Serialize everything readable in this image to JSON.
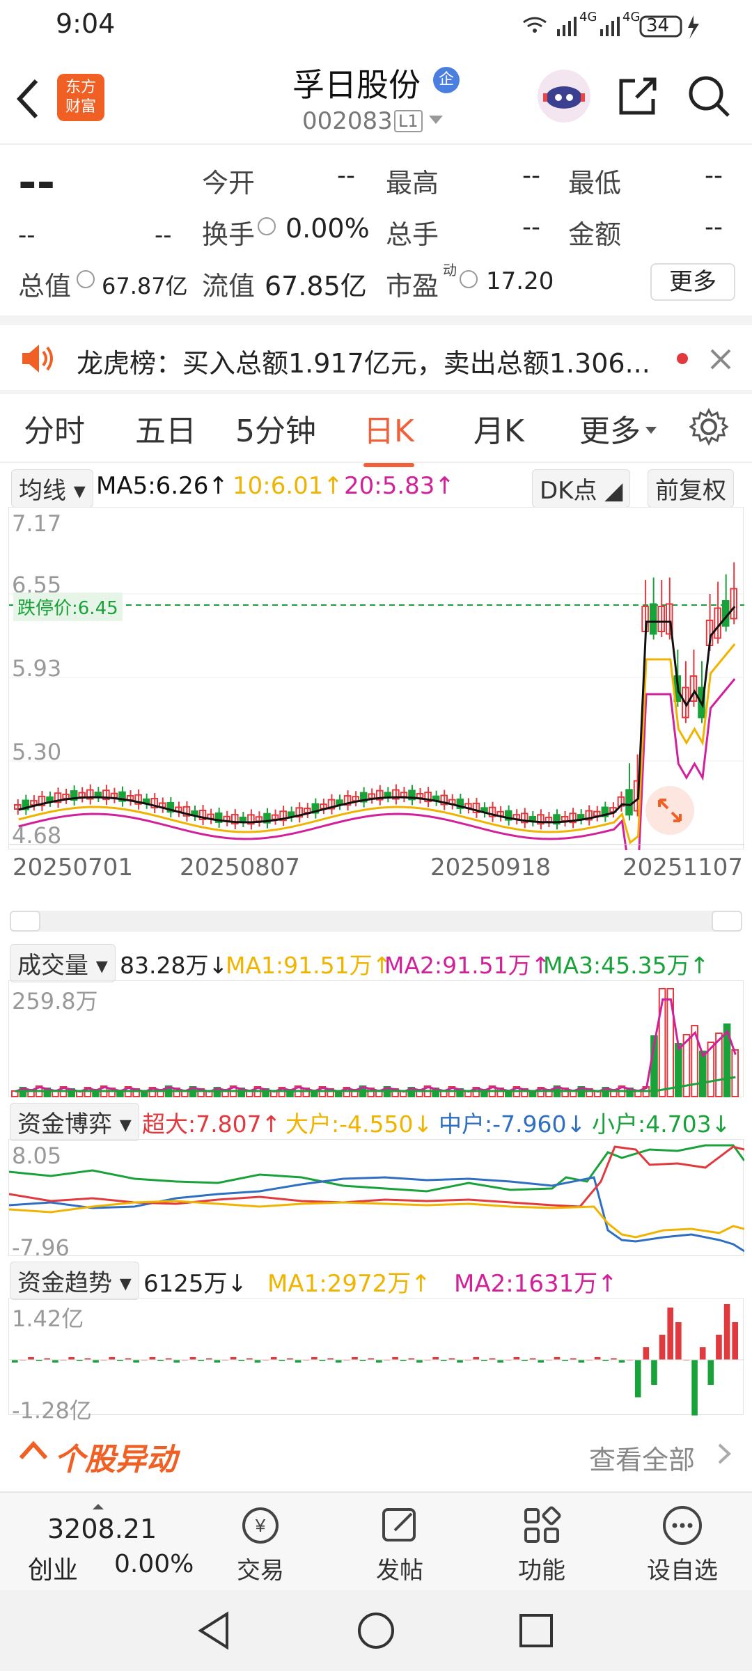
{
  "status": {
    "time": "9:04",
    "net1": "4G",
    "net2": "4G",
    "battery": "34"
  },
  "header": {
    "logo_text": "东方\n财富",
    "logo_line1": "东方",
    "logo_line2": "财富",
    "stock_name": "孚日股份",
    "stock_badge": "企",
    "stock_code": "002083",
    "level": "L1"
  },
  "quote": {
    "price": "--",
    "change_left": "--",
    "change_right": "--",
    "open_label": "今开",
    "open_value": "--",
    "high_label": "最高",
    "high_value": "--",
    "low_label": "最低",
    "low_value": "--",
    "turnover_rate_label": "换手",
    "turnover_rate_value": "0.00%",
    "volume_label": "总手",
    "volume_value": "--",
    "amount_label": "金额",
    "amount_value": "--",
    "total_mv_label": "总值",
    "total_mv_value": "67.87亿",
    "float_mv_label": "流值",
    "float_mv_value": "67.85亿",
    "pe_label": "市盈",
    "pe_sup": "动",
    "pe_value": "17.20",
    "more_button": "更多"
  },
  "notice": {
    "text": "龙虎榜：买入总额1.917亿元，卖出总额1.306..."
  },
  "tabs": [
    "分时",
    "五日",
    "5分钟",
    "日K",
    "月K",
    "更多"
  ],
  "active_tab": "日K",
  "kline": {
    "indicator_select": "均线",
    "ma5": "MA5:6.26↑",
    "ma10": "10:6.01↑",
    "ma20": "20:5.83↑",
    "dk_select": "DK点",
    "adjust_select": "前复权",
    "y_labels": [
      "7.17",
      "6.55",
      "5.93",
      "5.30",
      "4.68"
    ],
    "limit_down_label": "跌停价:6.45",
    "x_labels": [
      "20250701",
      "20250807",
      "20250918",
      "20251107"
    ]
  },
  "volume": {
    "select": "成交量",
    "value": "83.28万↓",
    "ma1": "MA1:91.51万↑",
    "ma2": "MA2:91.51万↑",
    "ma3": "MA3:45.35万↑",
    "y_max": "259.8万"
  },
  "fund_game": {
    "select": "资金博弈",
    "super": "超大:7.807↑",
    "large": "大户:-4.550↓",
    "medium": "中户:-7.960↓",
    "small": "小户:4.703↓",
    "y_max": "8.05",
    "y_min": "-7.96"
  },
  "fund_trend": {
    "select": "资金趋势",
    "value": "6125万↓",
    "ma1": "MA1:2972万↑",
    "ma2": "MA2:1631万↑",
    "y_max": "1.42亿",
    "y_min": "-1.28亿"
  },
  "movement": {
    "title": "个股异动",
    "view_all": "查看全部"
  },
  "bottom": {
    "index_value": "3208.21",
    "index_name": "创业",
    "index_change": "0.00%",
    "trade": "交易",
    "post": "发帖",
    "function": "功能",
    "watch": "设自选"
  },
  "colors": {
    "accent": "#f0603a",
    "up": "#e0393e",
    "down": "#1aa23a",
    "ma5": "#111111",
    "ma10": "#f0b400",
    "ma20": "#d1219a"
  }
}
